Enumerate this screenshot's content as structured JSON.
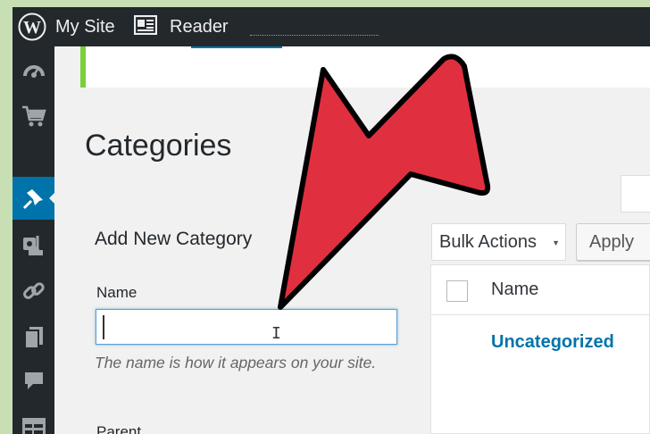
{
  "adminbar": {
    "site_label": "My Site",
    "reader_label": "Reader",
    "icons": [
      "wordpress-logo-icon",
      "reader-icon"
    ]
  },
  "sidebar": {
    "items": [
      {
        "icon": "dashboard-icon",
        "active": false
      },
      {
        "icon": "cart-icon",
        "active": false
      },
      {
        "icon": "pushpin-icon",
        "active": true
      },
      {
        "icon": "media-icon",
        "active": false
      },
      {
        "icon": "link-icon",
        "active": false
      },
      {
        "icon": "pages-icon",
        "active": false
      },
      {
        "icon": "comment-icon",
        "active": false
      },
      {
        "icon": "forms-icon",
        "active": false
      }
    ]
  },
  "page": {
    "title": "Categories"
  },
  "add_form": {
    "heading": "Add New Category",
    "name_label": "Name",
    "name_value": "",
    "name_description": "The name is how it appears on your site.",
    "parent_label": "Parent"
  },
  "table_actions": {
    "bulk_selected": "Bulk Actions",
    "apply_label": "Apply"
  },
  "table": {
    "columns": [
      "Name"
    ],
    "rows": [
      {
        "name": "Uncategorized"
      }
    ]
  },
  "colors": {
    "adminbar_bg": "#23282d",
    "active_menu": "#0073aa",
    "notice_border": "#7ad03a",
    "link": "#0073aa",
    "annotation_arrow": "#e0303f",
    "page_background": "#c8dfb4"
  }
}
